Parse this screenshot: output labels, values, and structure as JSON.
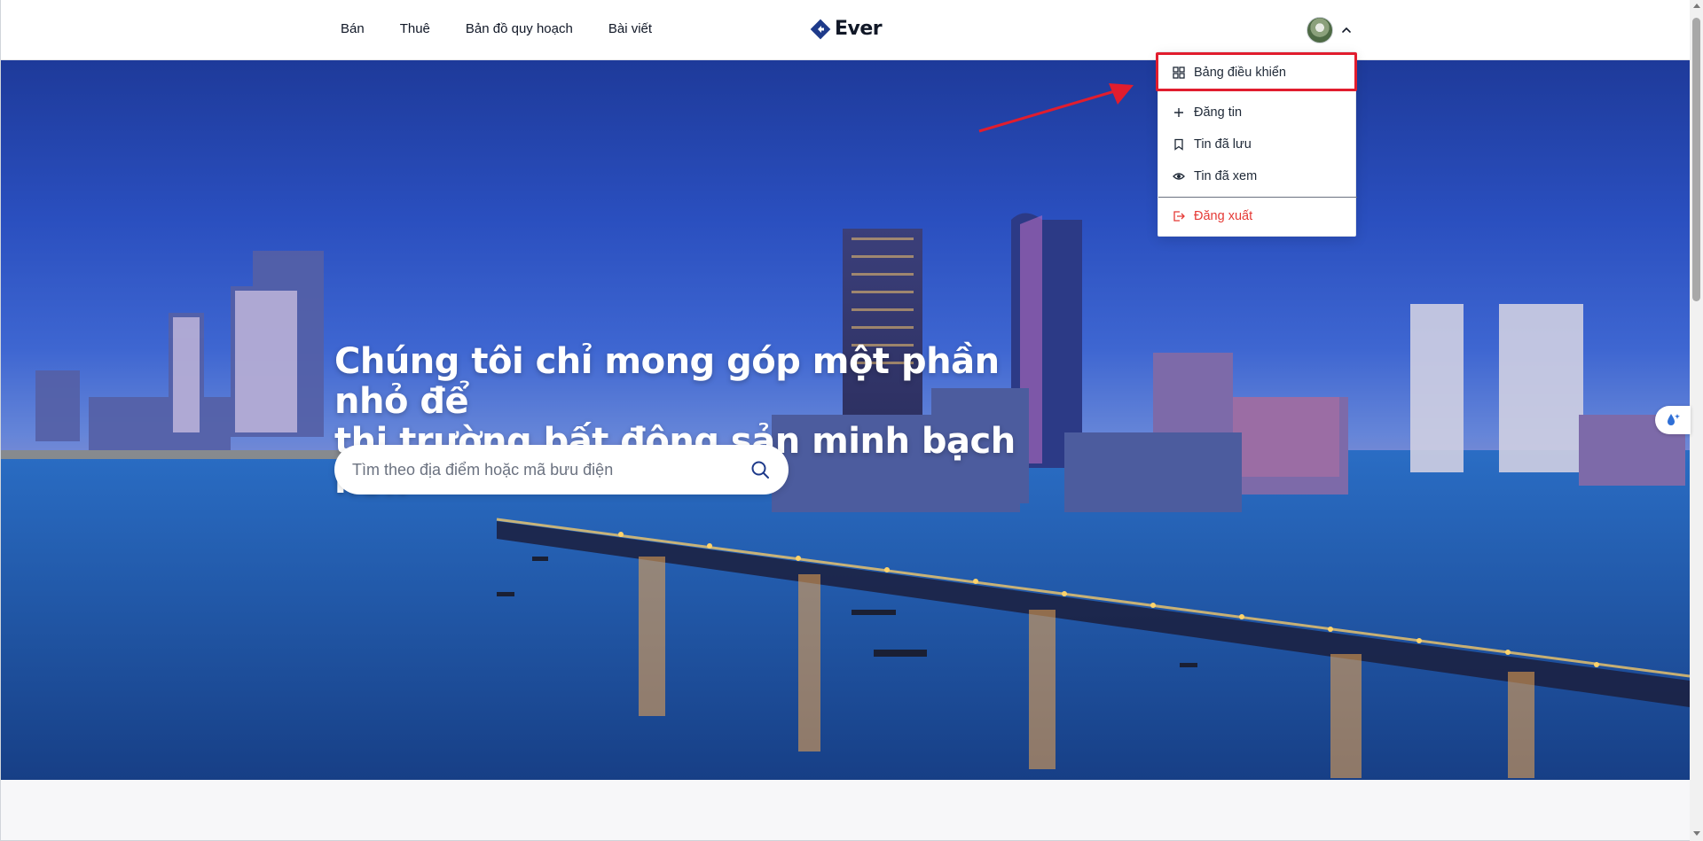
{
  "header": {
    "nav": [
      "Bán",
      "Thuê",
      "Bản đồ quy hoạch",
      "Bài viết"
    ],
    "logo_text": "Ever",
    "brand_color": "#1e3a8a"
  },
  "hero": {
    "headline_line1": "Chúng tôi chỉ mong góp một phần nhỏ để",
    "headline_line2": "thị trường bất động sản minh bạch hơn",
    "search_placeholder": "Tìm theo địa điểm hoặc mã bưu điện"
  },
  "user_menu": {
    "items": [
      {
        "label": "Bảng điều khiển",
        "icon": "dashboard-icon"
      },
      {
        "label": "Đăng tin",
        "icon": "plus-icon"
      },
      {
        "label": "Tin đã lưu",
        "icon": "bookmark-icon"
      },
      {
        "label": "Tin đã xem",
        "icon": "eye-icon"
      }
    ],
    "logout": {
      "label": "Đăng xuất",
      "icon": "logout-icon"
    },
    "logout_color": "#e53935"
  },
  "annotation": {
    "highlight_color": "#e11d2e"
  }
}
